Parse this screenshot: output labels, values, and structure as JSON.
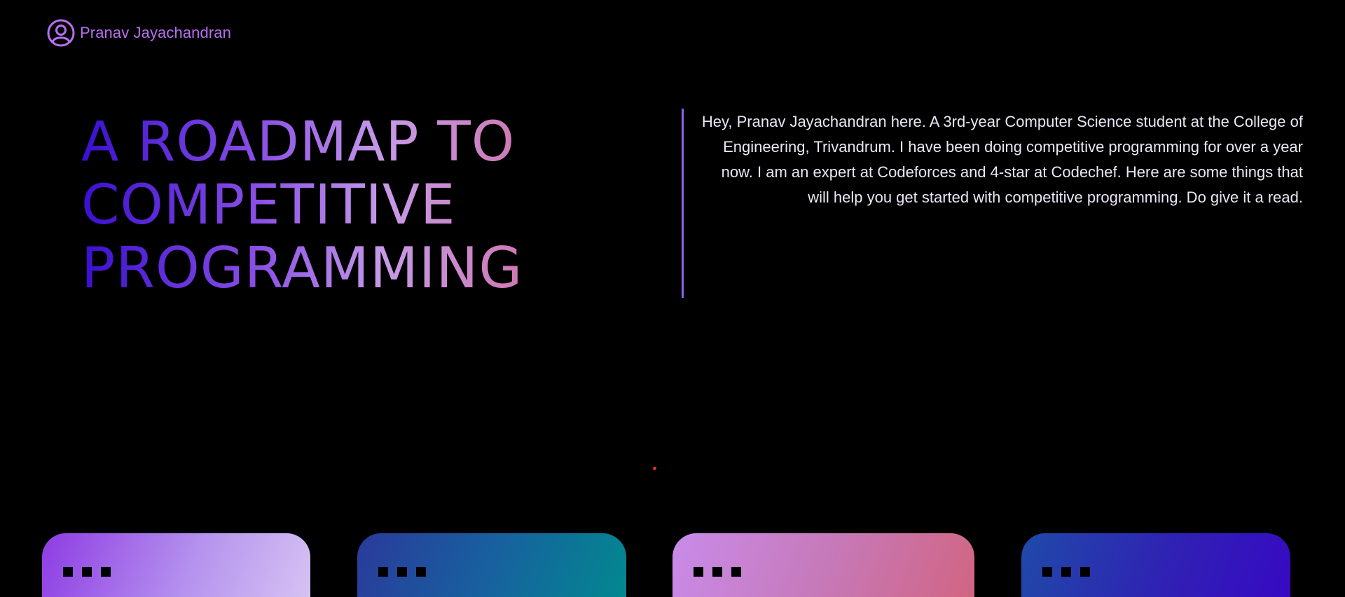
{
  "header": {
    "brand_name": "Pranav Jayachandran",
    "brand_icon": "user-circle-icon"
  },
  "hero": {
    "title_lines": [
      "A ROADMAP TO",
      "COMPETITIVE",
      "PROGRAMMING"
    ],
    "intro": "Hey, Pranav Jayachandran here. A 3rd-year Computer Science student at the College of Engineering, Trivandrum. I have been doing competitive programming for over a year now. I am an expert at Codeforces and 4-star at Codechef. Here are some things that will help you get started with competitive programming. Do give it a read."
  },
  "colors": {
    "background": "#000000",
    "brand": "#b86ff0",
    "divider": "#8d63e6",
    "title_gradient": [
      "#3a0fd0",
      "#8a4fe6",
      "#c79be8",
      "#d1699a"
    ],
    "indicator_dot": "#e0321e"
  },
  "cards": [
    {
      "id": "card-1",
      "gradient": [
        "#8e3ce4",
        "#d8c5f3"
      ],
      "window_controls": 3
    },
    {
      "id": "card-2",
      "gradient": [
        "#2a3a9c",
        "#018a8f"
      ],
      "window_controls": 3
    },
    {
      "id": "card-3",
      "gradient": [
        "#c98bea",
        "#d26480"
      ],
      "window_controls": 3
    },
    {
      "id": "card-4",
      "gradient": [
        "#1f4aa8",
        "#3708c4"
      ],
      "window_controls": 3
    }
  ]
}
